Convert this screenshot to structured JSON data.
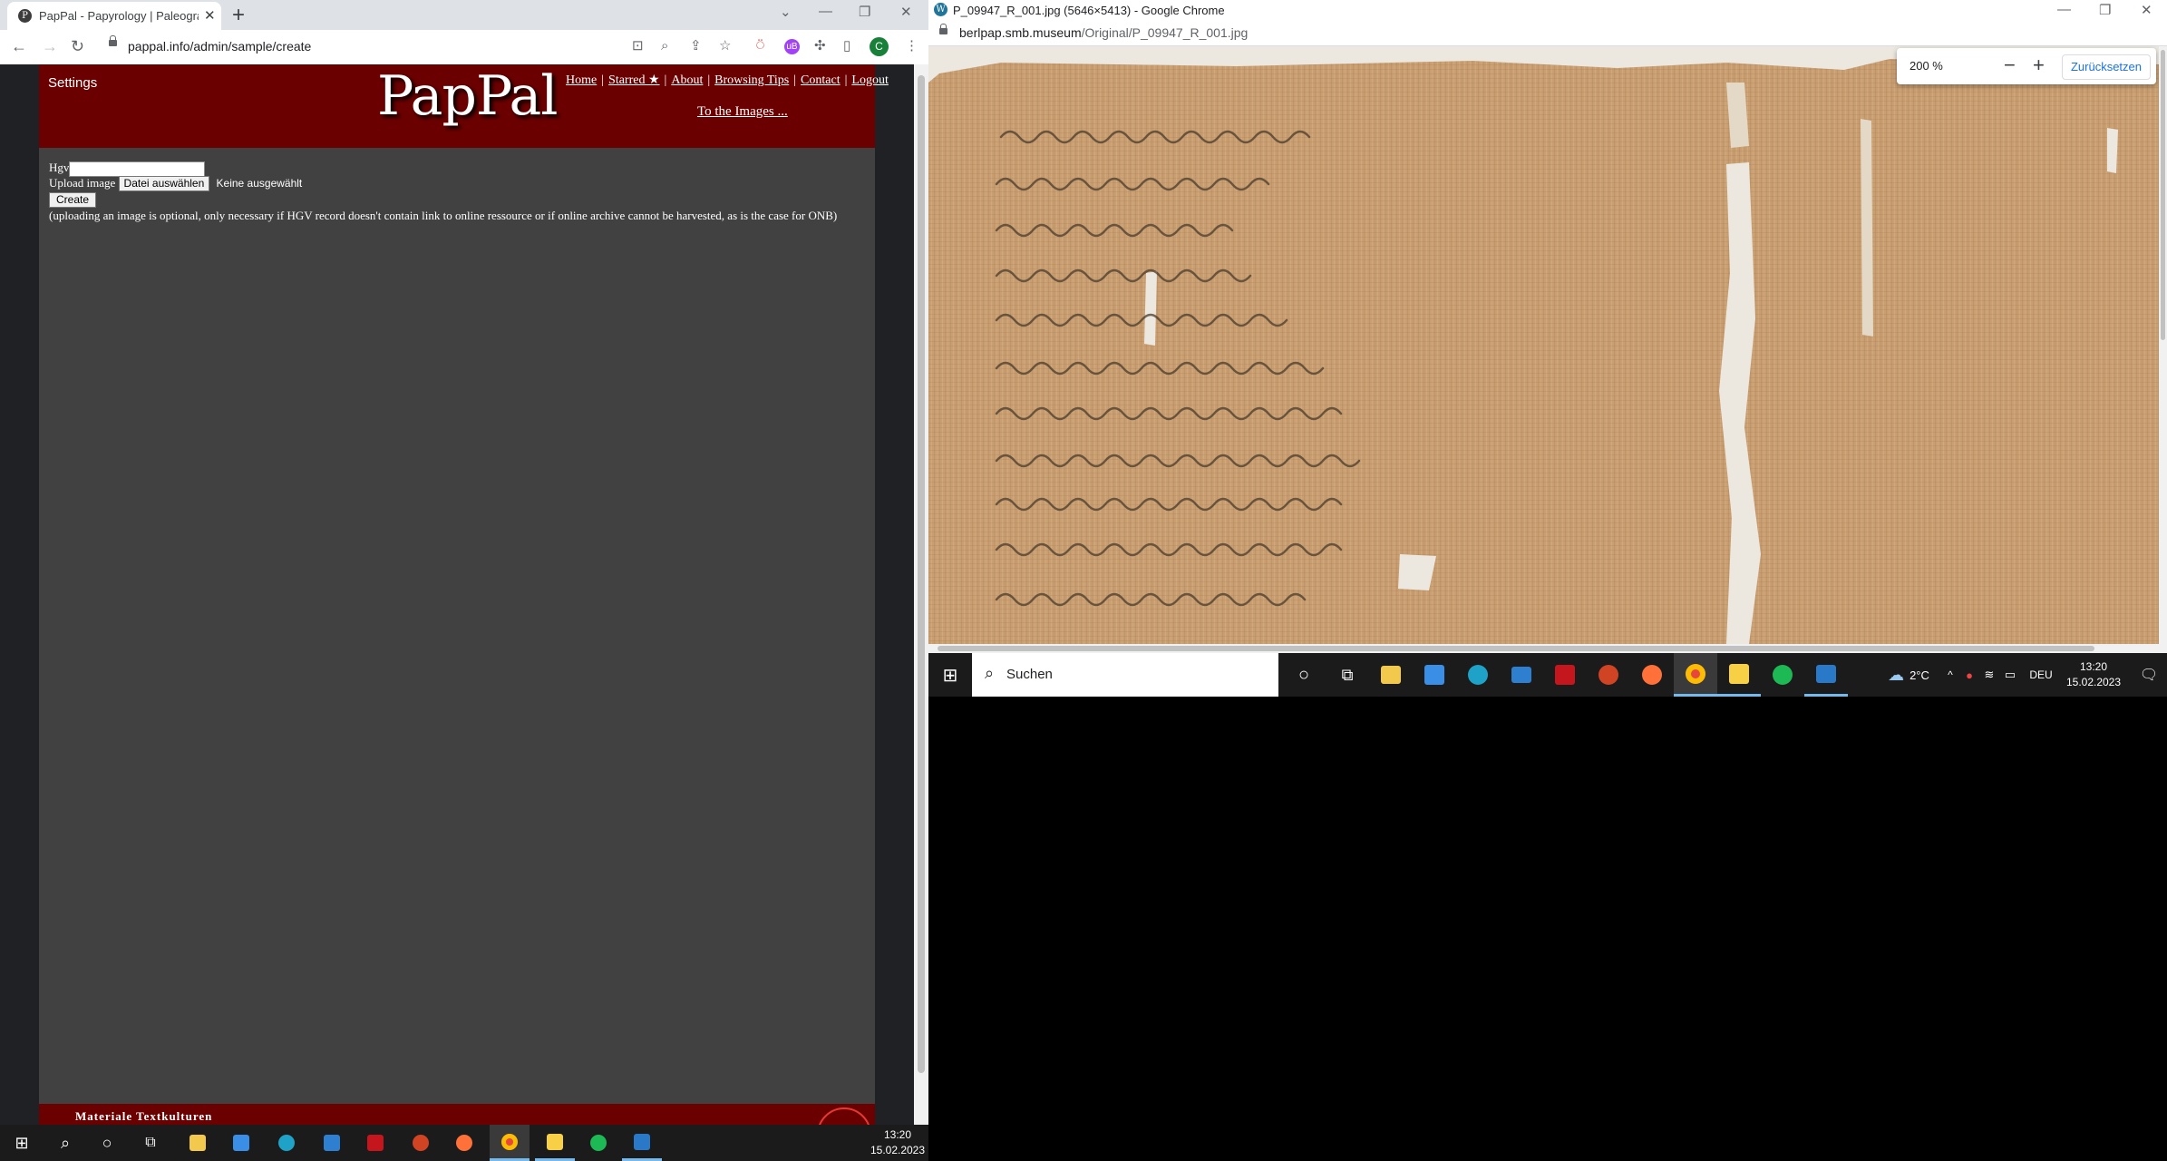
{
  "left_browser": {
    "tab_title": "PapPal - Papyrology | Paleograph",
    "url": "pappal.info/admin/sample/create"
  },
  "pappal": {
    "settings": "Settings",
    "logo": "PapPal",
    "nav": [
      "Home",
      "Starred ★",
      "About",
      "Browsing Tips",
      "Contact",
      "Logout"
    ],
    "to_images": "To the Images ...",
    "form": {
      "hgv_label": "Hgv",
      "hgv_value": "",
      "upload_label": "Upload image",
      "file_button": "Datei auswählen",
      "file_status": "Keine ausgewählt",
      "create_button": "Create",
      "note": "(uploading an image is optional, only necessary if HGV record doesn't contain link to online ressource or if online archive cannot be harvested, as is the case for ONB)"
    },
    "footer_text": "Materiale Textkulturen"
  },
  "right_browser": {
    "window_title": "P_09947_R_001.jpg (5646×5413) - Google Chrome",
    "url_domain": "berlpap.smb.museum",
    "url_path": "/Original/P_09947_R_001.jpg",
    "zoom": {
      "value": "200 %",
      "minus": "−",
      "plus": "+",
      "reset": "Zurücksetzen"
    }
  },
  "taskbar_right": {
    "search_placeholder": "Suchen",
    "weather": "2°C",
    "language": "DEU",
    "time": "13:20",
    "date": "15.02.2023"
  },
  "taskbar_left": {
    "time": "13:20",
    "date": "15.02.2023"
  },
  "colors": {
    "pappal_red": "#6b0000",
    "pappal_bg": "#414141",
    "chrome_blue": "#1a73e8",
    "taskbar": "#1b1b1b"
  }
}
